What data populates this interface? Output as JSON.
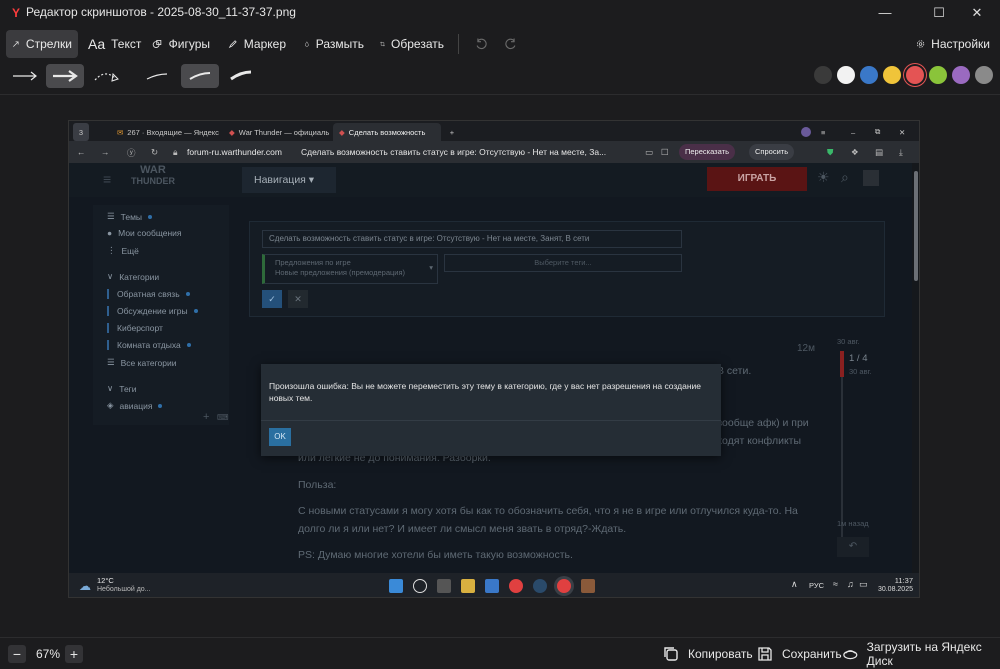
{
  "app": {
    "title": "Редактор скриншотов - 2025-08-30_11-37-37.png",
    "logo_letter": "Y",
    "window_controls": [
      "minimize-icon",
      "maximize-icon",
      "close-icon"
    ]
  },
  "toolbar": {
    "arrows": "Стрелки",
    "text": "Текст",
    "text_icon": "Aa",
    "shapes": "Фигуры",
    "marker": "Маркер",
    "blur": "Размыть",
    "crop": "Обрезать",
    "settings": "Настройки"
  },
  "arrow_styles": [
    "thin-arrow",
    "bold-arrow",
    "dotted-arrow",
    "brush-thin",
    "brush-medium",
    "brush-thick"
  ],
  "colors": [
    "#3a3a3a",
    "#f2f2f2",
    "#3a78c8",
    "#f0c43a",
    "#e45454",
    "#8ac43a",
    "#9a6ac0",
    "#8a8a8a"
  ],
  "selected_color": "#e45454",
  "screenshot": {
    "tabs": {
      "counter": "3",
      "tab1": "267 · Входящие — Яндекс",
      "tab2": "War Thunder — официаль",
      "tab3": "Сделать возможность"
    },
    "address": {
      "domain": "forum-ru.warthunder.com",
      "page_title": "Сделать возможность ставить статус в игре: Отсутствую - Нет на месте, За...",
      "retell": "Пересказать",
      "ask": "Спросить"
    },
    "forum": {
      "logo_line1": "WAR",
      "logo_line2": "THUNDER",
      "navigation": "Навигация",
      "play": "ИГРАТЬ",
      "sidebar": {
        "topics": "Темы",
        "my_messages": "Мои сообщения",
        "more": "Ещё",
        "categories": "Категории",
        "feedback": "Обратная связь",
        "discussion": "Обсуждение игры",
        "esport": "Киберспорт",
        "lounge": "Комната отдыха",
        "all_categories": "Все категории",
        "tags": "Теги",
        "aviation": "авиация"
      },
      "composer": {
        "title_value": "Сделать возможность ставить статус в игре: Отсутствую - Нет на месте, Занят, В сети",
        "category_line1": "Предложения по игре",
        "category_line2": "Новые предложения (премодерация)",
        "tags_placeholder": "Выберите теги..."
      },
      "post": {
        "time": "12м",
        "tail_text": "В сети.",
        "p1": "Постоянно сталкиваюсь с проблемой когда я отсутствую (не у экрана, отлучился или вообще афк) и при этом я же нахожусь в сети-без изменений. Меня пытаются пригласить в отряд. Происходят конфликты или лёгкие не до понимания. Разборки.",
        "p2": "Польза:",
        "p3": "С новыми статусами я могу хотя бы как то обозначить себя, что я не в игре или отлучился куда-то. На долго ли я или нет? И имеет ли смысл меня звать в отряд?-Ждать.",
        "p4": "PS: Думаю многие хотели бы иметь такую возможность."
      },
      "timeline": {
        "date_top": "30 авг.",
        "counter": "1 / 4",
        "date_sub": "30 авг.",
        "ago": "1м назад"
      },
      "dialog": {
        "message": "Произошла ошибка: Вы не можете переместить эту тему в категорию, где у вас нет разрешения на создание новых тем.",
        "ok": "OK"
      }
    },
    "taskbar": {
      "temp": "12°C",
      "weather": "Небольшой до...",
      "lang": "РУС",
      "time": "11:37",
      "date": "30.08.2025"
    }
  },
  "bottom": {
    "zoom": "67%",
    "copy": "Копировать",
    "save": "Сохранить",
    "upload": "Загрузить на Яндекс Диск"
  }
}
